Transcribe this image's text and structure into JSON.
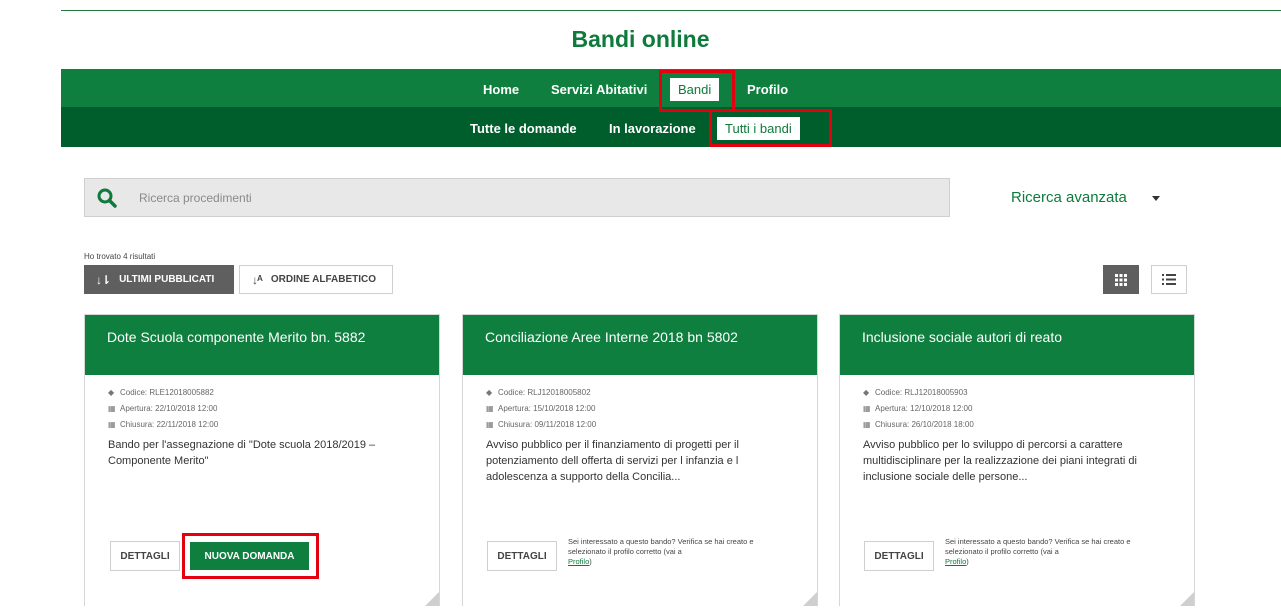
{
  "site": {
    "title": "Bandi online"
  },
  "nav": {
    "primary": [
      "Home",
      "Servizi Abitativi",
      "Bandi",
      "Profilo"
    ],
    "secondary": [
      "Tutte le domande",
      "In lavorazione",
      "Tutti i bandi"
    ]
  },
  "search": {
    "placeholder": "Ricerca procedimenti",
    "advanced_label": "Ricerca avanzata"
  },
  "results": {
    "summary": "Ho trovato 4 risultati"
  },
  "sort": {
    "latest_label": "ULTIMI PUBBLICATI",
    "alpha_label": "ORDINE ALFABETICO"
  },
  "labels": {
    "code": "Codice:",
    "open": "Apertura:",
    "close": "Chiusura:",
    "details": "DETTAGLI",
    "new_application": "NUOVA DOMANDA",
    "profile_note": "Sei interessato a questo bando? Verifica se hai creato e selezionato il profilo corretto (vai a",
    "profile_link": "Profilo",
    "profile_close": ")"
  },
  "cards": [
    {
      "title": "Dote Scuola componente Merito bn. 5882",
      "code": "RLE12018005882",
      "open": "22/10/2018 12:00",
      "close": "22/11/2018 12:00",
      "desc": "Bando per l'assegnazione di \"Dote scuola 2018/2019 – Componente Merito\""
    },
    {
      "title": "Conciliazione Aree Interne 2018 bn 5802",
      "code": "RLJ12018005802",
      "open": "15/10/2018 12:00",
      "close": "09/11/2018 12:00",
      "desc": "Avviso pubblico per il finanziamento di progetti per il potenziamento dell offerta di servizi per l infanzia e l adolescenza a supporto della Concilia..."
    },
    {
      "title": "Inclusione sociale autori di reato",
      "code": "RLJ12018005903",
      "open": "12/10/2018 12:00",
      "close": "26/10/2018 18:00",
      "desc": "Avviso pubblico per lo sviluppo di percorsi a carattere multidisciplinare per la realizzazione dei piani integrati di inclusione sociale delle persone..."
    }
  ],
  "colors": {
    "brand": "#0e7f3e",
    "brand_dark": "#005d2c",
    "highlight": "#e3000f"
  },
  "icons": [
    "search-icon",
    "chevron-down-icon",
    "sort-desc-icon",
    "sort-alpha-icon",
    "grid-view-icon",
    "list-view-icon",
    "tag-icon",
    "calendar-icon"
  ]
}
